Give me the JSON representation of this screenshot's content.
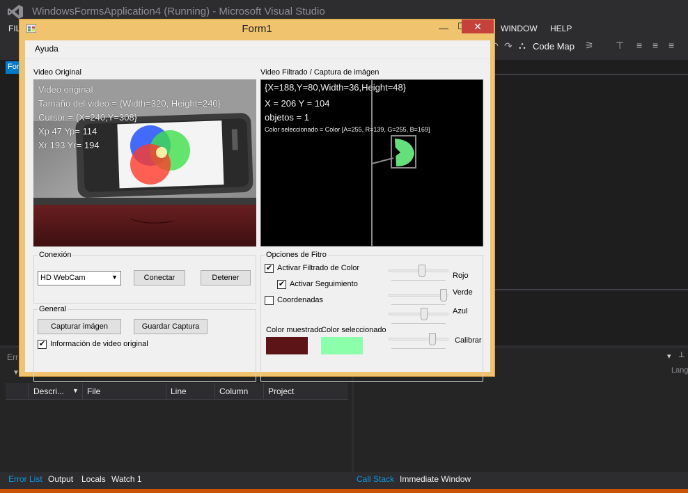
{
  "vs": {
    "title": "WindowsFormsApplication4 (Running) - Microsoft Visual Studio",
    "menu": {
      "file": "FIL",
      "window": "WINDOW",
      "help": "HELP"
    },
    "toolbar": {
      "code_map": "Code Map"
    },
    "left_tab": "For",
    "error_panel_header": "Err",
    "language_label": "Lang",
    "error_columns": [
      "Descri...",
      "File",
      "Line",
      "Column",
      "Project"
    ],
    "bottom_tabs_left": [
      "Error List",
      "Output",
      "Locals",
      "Watch 1"
    ],
    "bottom_tabs_right": [
      "Call Stack",
      "Immediate Window"
    ],
    "accent_color": "#007acc",
    "status_color": "#ca5100"
  },
  "form": {
    "title": "Form1",
    "menu_ayuda": "Ayuda",
    "video_original_label": "Video Original",
    "video_filtered_label": "Video Filtrado / Captura de imágen",
    "overlay_original": [
      "Video original",
      "Tamaño del video = {Width=320, Height=240}",
      "Cursor = {X=240,Y=308}",
      "Xp 47 Yp= 114",
      "Xr 193 Yr= 194"
    ],
    "overlay_filtered": {
      "rect": "{X=188,Y=80,Width=36,Height=48}",
      "xy": "X = 206 Y = 104",
      "objects": "objetos = 1",
      "color_selected": "Color seleccionado = Color [A=255, R=139, G=255, B=169]"
    },
    "conexion": {
      "legend": "Conexión",
      "camera_selected": "HD WebCam",
      "connect_button": "Conectar",
      "stop_button": "Detener"
    },
    "general": {
      "legend": "General",
      "capture_button": "Capturar imágen",
      "save_button": "Guardar Captura",
      "info_checkbox_label": "Información de video original",
      "info_checked": true
    },
    "filter_options": {
      "legend": "Opciones de Fitro",
      "activate_filter_label": "Activar Filtrado de Color",
      "activate_filter_checked": true,
      "activate_tracking_label": "Activar Seguimiento",
      "activate_tracking_checked": true,
      "coordinates_label": "Coordenadas",
      "coordinates_checked": false,
      "sample_color_label": "Color muestrado",
      "selected_color_label": "Color seleccionado",
      "sample_color": "#5c1416",
      "selected_color": "#8bffa9",
      "sliders": [
        {
          "label": "Rojo",
          "fraction": 0.56
        },
        {
          "label": "Verde",
          "fraction": 0.97
        },
        {
          "label": "Azul",
          "fraction": 0.6
        },
        {
          "label": "Calibrar",
          "fraction": 0.76
        }
      ]
    }
  }
}
